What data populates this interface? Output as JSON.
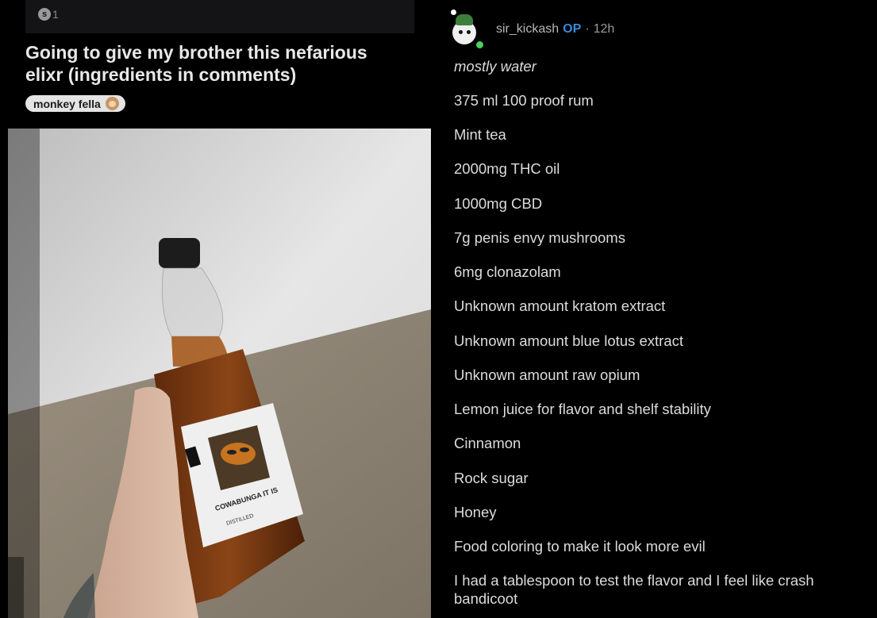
{
  "post": {
    "award_count": "1",
    "award_icon": "s",
    "title": "Going to give my brother this nefarious elixr (ingredients in comments)",
    "flair": "monkey fella",
    "flair_icon": "monkey-face-emoji",
    "photo": {
      "label_line1": "COWABUNGA IT IS",
      "label_line2": "DISTILLED"
    }
  },
  "comment": {
    "username": "sir_kickash",
    "op_tag": "OP",
    "separator": "·",
    "age": "12h",
    "lines": [
      "mostly water",
      "375 ml 100 proof rum",
      "Mint tea",
      "2000mg THC oil",
      "1000mg CBD",
      "7g penis envy mushrooms",
      "6mg clonazolam",
      "Unknown amount kratom extract",
      "Unknown amount blue lotus extract",
      "Unknown amount raw opium",
      "Lemon juice for flavor and shelf stability",
      "Cinnamon",
      "Rock sugar",
      "Honey",
      "Food coloring to make it look more evil",
      "I had a tablespoon to test the flavor and I feel like crash bandicoot"
    ]
  },
  "colors": {
    "background": "#000000",
    "op_blue": "#3b8ad9",
    "online_green": "#46d160",
    "liquid": "#7a3d12"
  }
}
